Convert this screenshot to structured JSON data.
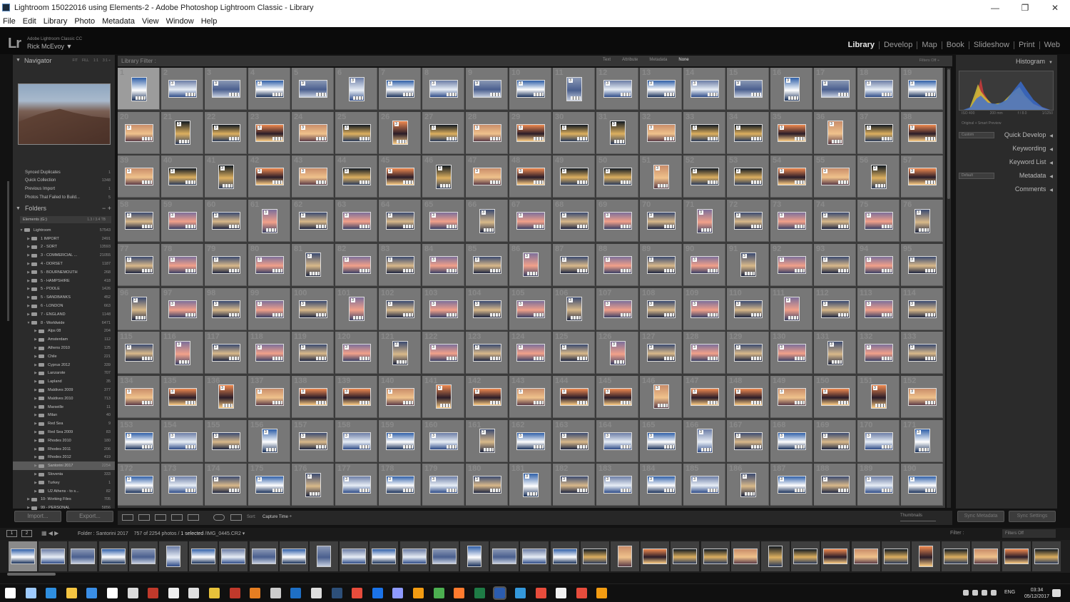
{
  "window": {
    "title": "Lightroom 15022016 using Elements-2 - Adobe Photoshop Lightroom Classic - Library",
    "min": "—",
    "max": "❐",
    "close": "✕"
  },
  "menu": [
    "File",
    "Edit",
    "Library",
    "Photo",
    "Metadata",
    "View",
    "Window",
    "Help"
  ],
  "identity": {
    "logo": "Lr",
    "product": "Adobe Lightroom Classic CC",
    "user": "Rick McEvoy ▼"
  },
  "modules": [
    "Library",
    "Develop",
    "Map",
    "Book",
    "Slideshow",
    "Print",
    "Web"
  ],
  "active_module": "Library",
  "navigator": {
    "label": "Navigator",
    "zoom_options": [
      "FIT",
      "FILL",
      "1:1",
      "3:1 ÷"
    ]
  },
  "catalog": [
    {
      "name": "Synced Duplicates",
      "count": "1"
    },
    {
      "name": "Quick Collection",
      "count": "1348"
    },
    {
      "name": "Previous Import",
      "count": "1"
    },
    {
      "name": "Photos That Failed to Build...",
      "count": "5"
    }
  ],
  "folders": {
    "label": "Folders",
    "volume": {
      "name": "Elements (G:)",
      "count": "1.3 / 3.4 TB"
    },
    "items": [
      {
        "name": "Lightroom",
        "count": "57543",
        "level": 0,
        "open": true
      },
      {
        "name": "1 IMPORT",
        "count": "2491",
        "level": 1
      },
      {
        "name": "2 - SORT",
        "count": "13593",
        "level": 1
      },
      {
        "name": "3 - COMMERCIAL ...",
        "count": "21055",
        "level": 1
      },
      {
        "name": "4 - DORSET",
        "count": "1187",
        "level": 1
      },
      {
        "name": "5 - BOURNEMOUTH",
        "count": "268",
        "level": 1
      },
      {
        "name": "5 - HAMPSHIRE",
        "count": "418",
        "level": 1
      },
      {
        "name": "5 - POOLE",
        "count": "1426",
        "level": 1
      },
      {
        "name": "5 - SANDBANKS",
        "count": "452",
        "level": 1
      },
      {
        "name": "6 - LONDON",
        "count": "663",
        "level": 1
      },
      {
        "name": "7 - ENGLAND",
        "count": "1148",
        "level": 1
      },
      {
        "name": "8 - Worldwide",
        "count": "6471",
        "level": 1,
        "open": true
      },
      {
        "name": "Alps 08",
        "count": "204",
        "level": 2
      },
      {
        "name": "Amsterdam",
        "count": "112",
        "level": 2
      },
      {
        "name": "Athens 2010",
        "count": "125",
        "level": 2
      },
      {
        "name": "Chile",
        "count": "221",
        "level": 2
      },
      {
        "name": "Cyprus 2012",
        "count": "339",
        "level": 2
      },
      {
        "name": "Lanzarote",
        "count": "707",
        "level": 2
      },
      {
        "name": "Lapland",
        "count": "35",
        "level": 2
      },
      {
        "name": "Maldives 2009",
        "count": "377",
        "level": 2
      },
      {
        "name": "Maldives 2010",
        "count": "713",
        "level": 2
      },
      {
        "name": "Marseille",
        "count": "11",
        "level": 2
      },
      {
        "name": "Milan",
        "count": "40",
        "level": 2
      },
      {
        "name": "Red Sea",
        "count": "9",
        "level": 2
      },
      {
        "name": "Red Sea 2009",
        "count": "83",
        "level": 2
      },
      {
        "name": "Rhodes 2010",
        "count": "180",
        "level": 2
      },
      {
        "name": "Rhodes 2011",
        "count": "206",
        "level": 2
      },
      {
        "name": "Rhodes 2012",
        "count": "419",
        "level": 2
      },
      {
        "name": "Santorini 2017",
        "count": "2254",
        "level": 2,
        "selected": true
      },
      {
        "name": "Slovenia",
        "count": "333",
        "level": 2
      },
      {
        "name": "Turkey",
        "count": "1",
        "level": 2
      },
      {
        "name": "U2 Athens - to s...",
        "count": "82",
        "level": 2
      },
      {
        "name": "10- Working Files",
        "count": "705",
        "level": 1
      },
      {
        "name": "99 - PERSONAL",
        "count": "5856",
        "level": 1
      }
    ]
  },
  "buttons": {
    "import": "Import...",
    "export": "Export...",
    "sync_metadata": "Sync Metadata",
    "sync_settings": "Sync Settings"
  },
  "filter_bar": {
    "label": "Library Filter :",
    "options": [
      "Text",
      "Attribute",
      "Metadata",
      "None"
    ],
    "active": "None",
    "filters_off": "Filters Off ÷"
  },
  "grid": {
    "first_number": 1,
    "rows": 10,
    "cols": 19,
    "selected_index": 0
  },
  "toolbar": {
    "sort_label": "Sort:",
    "sort_value": "Capture Time ÷",
    "thumbnails_label": "Thumbnails"
  },
  "right_panel": {
    "histogram_label": "Histogram",
    "histogram_info": [
      "ISO 400",
      "200 mm",
      "f / 8.0",
      "1/1250"
    ],
    "original_preview": "Original + Smart Preview",
    "sections": [
      "Quick Develop",
      "Keywording",
      "Keyword List",
      "Metadata",
      "Comments"
    ],
    "qd_preset": "Custom",
    "md_preset": "Default"
  },
  "filmstrip_bar": {
    "pages": [
      "1",
      "2"
    ],
    "folder": "Folder : Santorini 2017",
    "count": "757 of 2254 photos /",
    "selected": "1 selected",
    "file": "/IMG_0445.CR2 ▾",
    "filter_label": "Filter :",
    "filters_off": "Filters Off"
  },
  "taskbar": {
    "lang": "ENG",
    "time": "03:34",
    "date": "05/12/2017"
  },
  "colors": {
    "accent": "#0078d7",
    "panel": "#2b2b2b",
    "grid_cell": "#777777",
    "selected_cell": "#9c9c9c"
  }
}
